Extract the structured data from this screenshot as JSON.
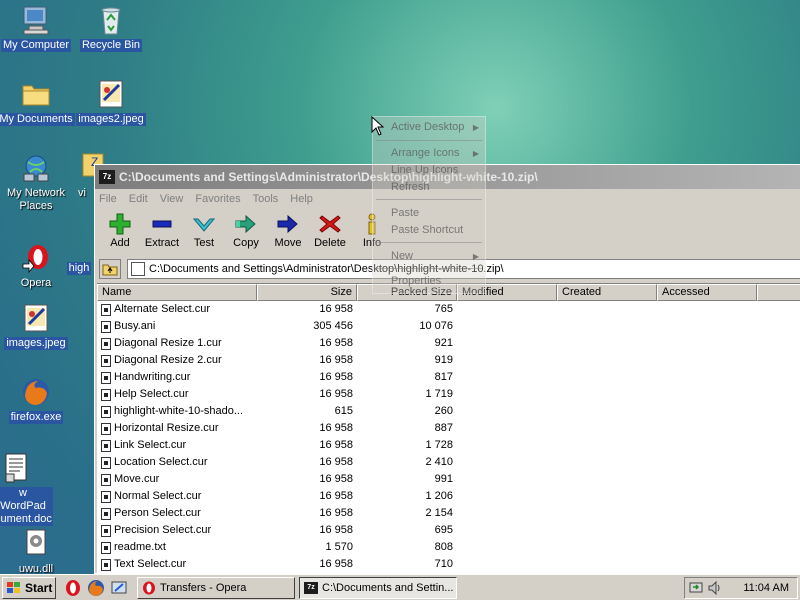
{
  "desktop": {
    "icons": [
      {
        "label": "My Computer"
      },
      {
        "label": "Recycle Bin"
      },
      {
        "label": "My Documents"
      },
      {
        "label": "images2.jpeg"
      },
      {
        "label": "My Network Places"
      },
      {
        "label": "Opera"
      },
      {
        "label": "images.jpeg"
      },
      {
        "label": "firefox.exe"
      },
      {
        "label": "w WordPad cument.doc"
      },
      {
        "label": "uwu.dll"
      },
      {
        "label": "vi"
      },
      {
        "label": "high"
      }
    ]
  },
  "context_menu": {
    "items": [
      {
        "label": "Active Desktop"
      },
      {
        "label": "Arrange Icons"
      },
      {
        "label": "Line Up Icons"
      },
      {
        "label": "Refresh"
      },
      {
        "label": "Paste"
      },
      {
        "label": "Paste Shortcut"
      },
      {
        "label": "New"
      },
      {
        "label": "Properties"
      }
    ]
  },
  "window": {
    "title": "C:\\Documents and Settings\\Administrator\\Desktop\\highlight-white-10.zip\\",
    "app_icon_text": "7z",
    "menu": [
      "File",
      "Edit",
      "View",
      "Favorites",
      "Tools",
      "Help"
    ],
    "toolbar": [
      "Add",
      "Extract",
      "Test",
      "Copy",
      "Move",
      "Delete",
      "Info"
    ],
    "address": "C:\\Documents and Settings\\Administrator\\Desktop\\highlight-white-10.zip\\",
    "columns": [
      "Name",
      "Size",
      "Packed Size",
      "Modified",
      "Created",
      "Accessed"
    ],
    "rows": [
      {
        "name": "Alternate Select.cur",
        "size": "16 958",
        "packed": "765"
      },
      {
        "name": "Busy.ani",
        "size": "305 456",
        "packed": "10 076"
      },
      {
        "name": "Diagonal Resize 1.cur",
        "size": "16 958",
        "packed": "921"
      },
      {
        "name": "Diagonal Resize 2.cur",
        "size": "16 958",
        "packed": "919"
      },
      {
        "name": "Handwriting.cur",
        "size": "16 958",
        "packed": "817"
      },
      {
        "name": "Help Select.cur",
        "size": "16 958",
        "packed": "1 719"
      },
      {
        "name": "highlight-white-10-shado...",
        "size": "615",
        "packed": "260"
      },
      {
        "name": "Horizontal Resize.cur",
        "size": "16 958",
        "packed": "887"
      },
      {
        "name": "Link Select.cur",
        "size": "16 958",
        "packed": "1 728"
      },
      {
        "name": "Location Select.cur",
        "size": "16 958",
        "packed": "2 410"
      },
      {
        "name": "Move.cur",
        "size": "16 958",
        "packed": "991"
      },
      {
        "name": "Normal Select.cur",
        "size": "16 958",
        "packed": "1 206"
      },
      {
        "name": "Person Select.cur",
        "size": "16 958",
        "packed": "2 154"
      },
      {
        "name": "Precision Select.cur",
        "size": "16 958",
        "packed": "695"
      },
      {
        "name": "readme.txt",
        "size": "1 570",
        "packed": "808"
      },
      {
        "name": "Text Select.cur",
        "size": "16 958",
        "packed": "710"
      }
    ]
  },
  "taskbar": {
    "start_label": "Start",
    "tasks": [
      {
        "label": "Transfers - Opera"
      },
      {
        "label": "C:\\Documents and Settin..."
      }
    ],
    "clock": "11:04 AM"
  }
}
